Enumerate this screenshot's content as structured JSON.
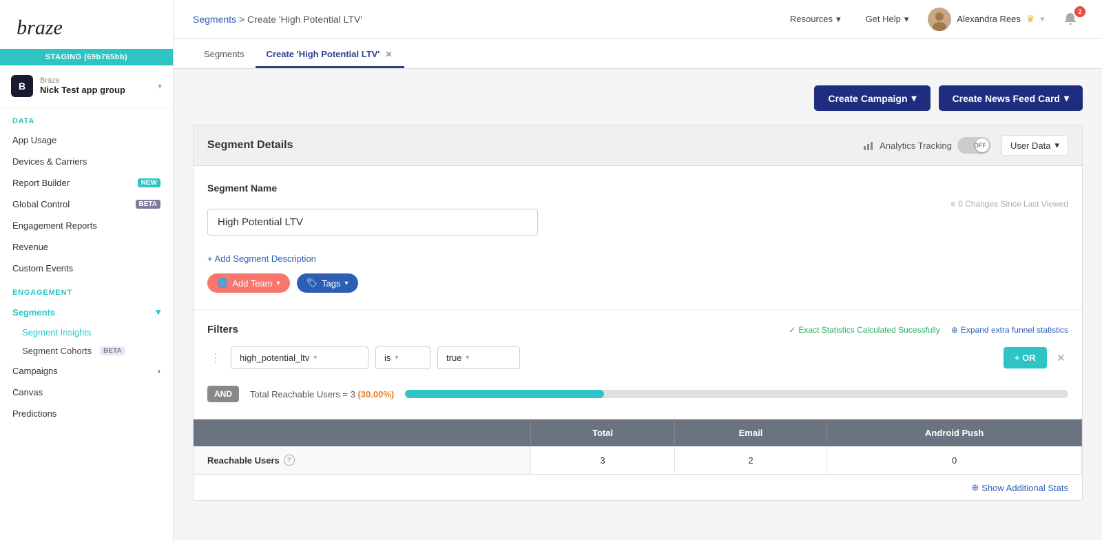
{
  "sidebar": {
    "logo_text": "braze",
    "staging_badge": "STAGING (69b765bb)",
    "app_icon_letter": "B",
    "company": "Braze",
    "app_group": "Nick Test app group",
    "data_section_label": "DATA",
    "engagement_section_label": "ENGAGEMENT",
    "data_items": [
      {
        "label": "App Usage",
        "badge": null
      },
      {
        "label": "Devices & Carriers",
        "badge": null
      },
      {
        "label": "Report Builder",
        "badge": "NEW"
      },
      {
        "label": "Global Control",
        "badge": "BETA"
      },
      {
        "label": "Engagement Reports",
        "badge": null
      },
      {
        "label": "Revenue",
        "badge": null
      },
      {
        "label": "Custom Events",
        "badge": null
      }
    ],
    "engagement_items": [
      {
        "label": "Segments",
        "has_children": true
      },
      {
        "label": "Campaigns",
        "has_children": true
      },
      {
        "label": "Canvas",
        "has_children": false
      }
    ],
    "segment_sub_items": [
      {
        "label": "Segment Insights",
        "badge": null
      },
      {
        "label": "Segment Cohorts",
        "badge": "BETA"
      }
    ]
  },
  "topbar": {
    "breadcrumb_segments": "Segments",
    "breadcrumb_separator": ">",
    "breadcrumb_current": "Create 'High Potential LTV'",
    "resources_label": "Resources",
    "get_help_label": "Get Help",
    "username": "Alexandra Rees",
    "notification_count": "2"
  },
  "tabs": [
    {
      "label": "Segments",
      "active": false,
      "closeable": false
    },
    {
      "label": "Create 'High Potential LTV'",
      "active": true,
      "closeable": true
    }
  ],
  "page": {
    "create_campaign_label": "Create Campaign",
    "create_news_feed_label": "Create News Feed Card",
    "segment_details_title": "Segment Details",
    "analytics_tracking_label": "Analytics Tracking",
    "toggle_state": "OFF",
    "user_data_label": "User Data",
    "segment_name_label": "Segment Name",
    "segment_name_value": "High Potential LTV",
    "changes_note": "0 Changes Since Last Viewed",
    "add_desc_label": "+ Add Segment Description",
    "add_team_label": "Add Team",
    "tags_label": "Tags",
    "filters_title": "Filters",
    "stats_calculated": "Exact Statistics Calculated Sucessfully",
    "expand_funnel": "Expand extra funnel statistics",
    "filter_field_value": "high_potential_ltv",
    "filter_operator_value": "is",
    "filter_value_value": "true",
    "or_label": "+ OR",
    "and_label": "AND",
    "total_reachable_label": "Total Reachable Users = 3",
    "total_reachable_percent": "(30.00%)",
    "progress_percent": 30,
    "table_headers": [
      "",
      "Total",
      "Email",
      "Android Push"
    ],
    "table_rows": [
      {
        "label": "Reachable Users",
        "has_info": true,
        "total": "3",
        "email": "2",
        "android_push": "0"
      }
    ],
    "show_additional_stats": "Show Additional Stats"
  }
}
